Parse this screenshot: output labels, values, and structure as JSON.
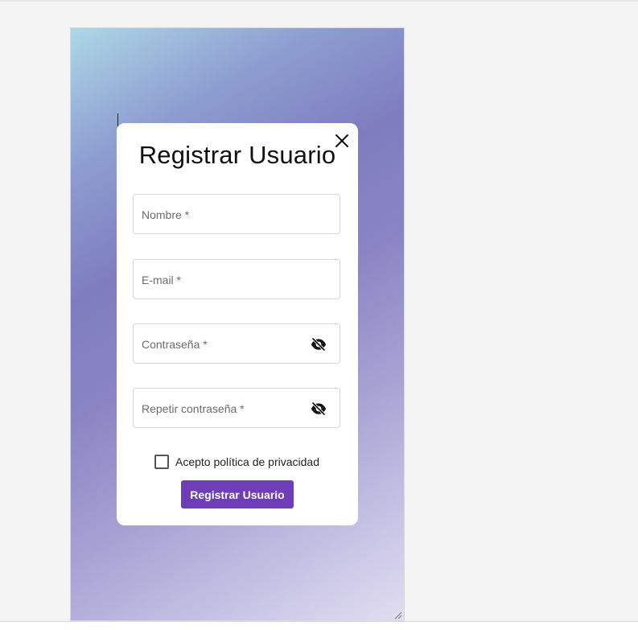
{
  "modal": {
    "title": "Registrar Usuario",
    "close_icon": "close-icon"
  },
  "fields": {
    "name": {
      "placeholder": "Nombre *"
    },
    "email": {
      "placeholder": "E-mail *"
    },
    "password": {
      "placeholder": "Contraseña *",
      "toggle_icon": "eye-off-icon"
    },
    "repeat_password": {
      "placeholder": "Repetir contraseña *",
      "toggle_icon": "eye-off-icon"
    }
  },
  "consent": {
    "label": "Acepto política de privacidad",
    "checked": false
  },
  "submit": {
    "label": "Registrar Usuario"
  },
  "colors": {
    "accent": "#6f3db8",
    "gradient_start": "#add8e6",
    "gradient_mid": "#7f7dbf",
    "gradient_end": "#e1def0"
  }
}
